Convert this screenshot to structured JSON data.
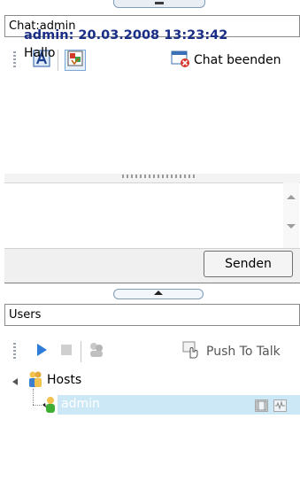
{
  "chat": {
    "title": "Chat:admin",
    "toolbar": {
      "end_chat_label": "Chat beenden"
    },
    "messages": [
      {
        "meta": "admin: 20.03.2008 13:23:42",
        "text": "Hallo"
      }
    ],
    "input": {
      "value": ""
    },
    "send_label": "Senden"
  },
  "users": {
    "title": "Users",
    "toolbar": {
      "push_to_talk_label": "Push To Talk"
    },
    "tree": {
      "group_label": "Hosts",
      "members": [
        {
          "name": "admin"
        }
      ]
    }
  },
  "colors": {
    "message_meta": "#1a2e88",
    "selection": "#cce8f6",
    "play_accent": "#2f7bd8"
  }
}
